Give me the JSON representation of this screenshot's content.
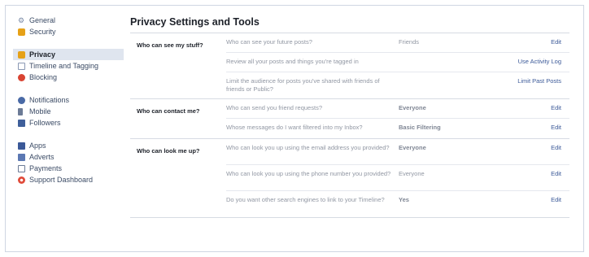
{
  "sidebar": {
    "groups": [
      [
        {
          "label": "General",
          "icon": "gear-icon"
        },
        {
          "label": "Security",
          "icon": "security-badge-icon"
        }
      ],
      [
        {
          "label": "Privacy",
          "icon": "lock-icon",
          "active": true
        },
        {
          "label": "Timeline and Tagging",
          "icon": "timeline-icon"
        },
        {
          "label": "Blocking",
          "icon": "blocking-icon"
        }
      ],
      [
        {
          "label": "Notifications",
          "icon": "globe-icon"
        },
        {
          "label": "Mobile",
          "icon": "mobile-icon"
        },
        {
          "label": "Followers",
          "icon": "followers-icon"
        }
      ],
      [
        {
          "label": "Apps",
          "icon": "apps-icon"
        },
        {
          "label": "Adverts",
          "icon": "adverts-icon"
        },
        {
          "label": "Payments",
          "icon": "payments-icon"
        },
        {
          "label": "Support Dashboard",
          "icon": "support-icon"
        }
      ]
    ]
  },
  "main": {
    "title": "Privacy Settings and Tools",
    "sections": [
      {
        "label": "Who can see my stuff?",
        "rows": [
          {
            "question": "Who can see your future posts?",
            "value": "Friends",
            "action": "Edit"
          },
          {
            "question": "Review all your posts and things you're tagged in",
            "value": "",
            "action": "Use Activity Log"
          },
          {
            "question": "Limit the audience for posts you've shared with friends of friends or Public?",
            "value": "",
            "action": "Limit Past Posts"
          }
        ]
      },
      {
        "label": "Who can contact me?",
        "rows": [
          {
            "question": "Who can send you friend requests?",
            "value": "Everyone",
            "action": "Edit"
          },
          {
            "question": "Whose messages do I want filtered into my Inbox?",
            "value": "Basic Filtering",
            "action": "Edit"
          }
        ]
      },
      {
        "label": "Who can look me up?",
        "rows": [
          {
            "question": "Who can look you up using the email address you provided?",
            "value": "Everyone",
            "action": "Edit"
          },
          {
            "question": "Who can look you up using the phone number you provided?",
            "value": "Everyone",
            "action": "Edit"
          },
          {
            "question": "Do you want other search engines to link to your Timeline?",
            "value": "Yes",
            "action": "Edit"
          }
        ]
      }
    ]
  }
}
